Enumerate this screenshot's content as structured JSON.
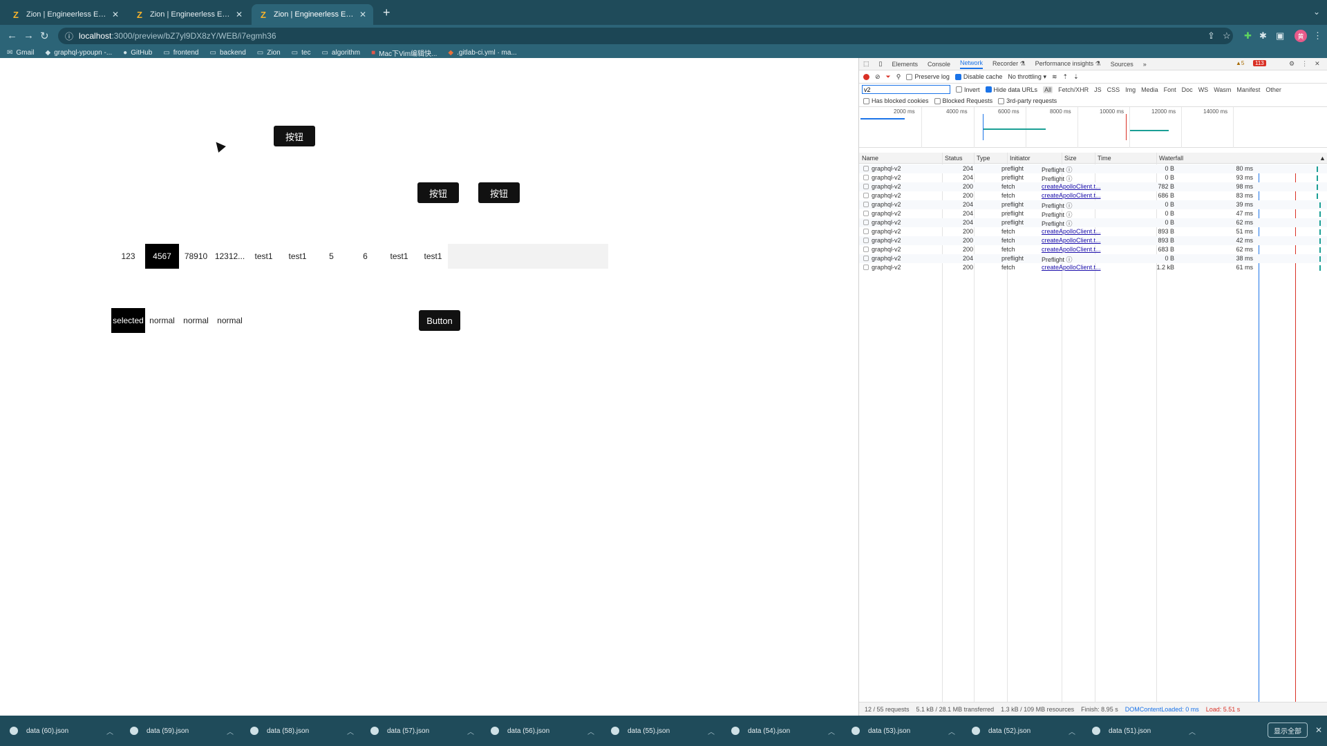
{
  "browser": {
    "tabs": [
      {
        "title": "Zion | Engineerless Engineering"
      },
      {
        "title": "Zion | Engineerless Engineering"
      },
      {
        "title": "Zion | Engineerless Engineering"
      }
    ],
    "active_tab_index": 2,
    "favicon_letter": "Z",
    "new_tab": "+",
    "url_host": "localhost",
    "url_path": ":3000/preview/bZ7yl9DX8zY/WEB/i7egmh36",
    "profile_initial": "黄"
  },
  "bookmarks": [
    {
      "label": "Gmail"
    },
    {
      "label": "graphql-ypoupn -..."
    },
    {
      "label": "GitHub"
    },
    {
      "label": "frontend"
    },
    {
      "label": "backend"
    },
    {
      "label": "Zion"
    },
    {
      "label": "tec"
    },
    {
      "label": "algorithm"
    },
    {
      "label": "Mac下Vim编辑快..."
    },
    {
      "label": ".gitlab-ci.yml · ma..."
    }
  ],
  "page": {
    "btn1": "按钮",
    "btn2": "按钮",
    "btn3": "按钮",
    "tabs": [
      "123",
      "4567",
      "78910",
      "12312...",
      "test1",
      "test1",
      "5",
      "6",
      "test1",
      "test1"
    ],
    "selected_tab_index": 1,
    "segments": [
      "selected",
      "normal",
      "normal",
      "normal"
    ],
    "button": "Button"
  },
  "devtools": {
    "tabs": [
      "Elements",
      "Console",
      "Network",
      "Recorder ⚗",
      "Performance insights ⚗",
      "Sources",
      "»"
    ],
    "active_tab": "Network",
    "warnings": "▲5",
    "errors": "113",
    "preserve_log": "Preserve log",
    "disable_cache": "Disable cache",
    "throttling": "No throttling",
    "filter_value": "v2",
    "invert": "Invert",
    "hide_data_urls": "Hide data URLs",
    "type_filters": [
      "All",
      "Fetch/XHR",
      "JS",
      "CSS",
      "Img",
      "Media",
      "Font",
      "Doc",
      "WS",
      "Wasm",
      "Manifest",
      "Other"
    ],
    "has_blocked_cookies": "Has blocked cookies",
    "blocked_requests": "Blocked Requests",
    "third_party": "3rd-party requests",
    "overview_ticks": [
      "2000 ms",
      "4000 ms",
      "6000 ms",
      "8000 ms",
      "10000 ms",
      "12000 ms",
      "14000 ms"
    ],
    "columns": [
      "Name",
      "Status",
      "Type",
      "Initiator",
      "Size",
      "Time",
      "Waterfall"
    ],
    "requests": [
      {
        "name": "graphql-v2",
        "status": "204",
        "type": "preflight",
        "initiator": "Preflight ⓘ",
        "size": "0 B",
        "time": "80 ms"
      },
      {
        "name": "graphql-v2",
        "status": "204",
        "type": "preflight",
        "initiator": "Preflight ⓘ",
        "size": "0 B",
        "time": "93 ms"
      },
      {
        "name": "graphql-v2",
        "status": "200",
        "type": "fetch",
        "initiator": "createApolloClient.t...",
        "size": "782 B",
        "time": "98 ms"
      },
      {
        "name": "graphql-v2",
        "status": "200",
        "type": "fetch",
        "initiator": "createApolloClient.t...",
        "size": "686 B",
        "time": "83 ms"
      },
      {
        "name": "graphql-v2",
        "status": "204",
        "type": "preflight",
        "initiator": "Preflight ⓘ",
        "size": "0 B",
        "time": "39 ms"
      },
      {
        "name": "graphql-v2",
        "status": "204",
        "type": "preflight",
        "initiator": "Preflight ⓘ",
        "size": "0 B",
        "time": "47 ms"
      },
      {
        "name": "graphql-v2",
        "status": "204",
        "type": "preflight",
        "initiator": "Preflight ⓘ",
        "size": "0 B",
        "time": "62 ms"
      },
      {
        "name": "graphql-v2",
        "status": "200",
        "type": "fetch",
        "initiator": "createApolloClient.t...",
        "size": "893 B",
        "time": "51 ms"
      },
      {
        "name": "graphql-v2",
        "status": "200",
        "type": "fetch",
        "initiator": "createApolloClient.t...",
        "size": "893 B",
        "time": "42 ms"
      },
      {
        "name": "graphql-v2",
        "status": "200",
        "type": "fetch",
        "initiator": "createApolloClient.t...",
        "size": "683 B",
        "time": "62 ms"
      },
      {
        "name": "graphql-v2",
        "status": "204",
        "type": "preflight",
        "initiator": "Preflight ⓘ",
        "size": "0 B",
        "time": "38 ms"
      },
      {
        "name": "graphql-v2",
        "status": "200",
        "type": "fetch",
        "initiator": "createApolloClient.t...",
        "size": "1.2 kB",
        "time": "61 ms"
      }
    ],
    "status_bar": {
      "requests": "12 / 55 requests",
      "transferred": "5.1 kB / 28.1 MB transferred",
      "resources": "1.3 kB / 109 MB resources",
      "finish": "Finish: 8.95 s",
      "dcl": "DOMContentLoaded: 0 ms",
      "load": "Load: 5.51 s"
    }
  },
  "downloads": {
    "items": [
      "data (60).json",
      "data (59).json",
      "data (58).json",
      "data (57).json",
      "data (56).json",
      "data (55).json",
      "data (54).json",
      "data (53).json",
      "data (52).json",
      "data (51).json"
    ],
    "show_all": "显示全部"
  },
  "colors": {
    "chrome_bg": "#1f4b5a",
    "toolbar_bg": "#2c6477",
    "accent_blue": "#1a73e8",
    "error_red": "#d93025"
  }
}
